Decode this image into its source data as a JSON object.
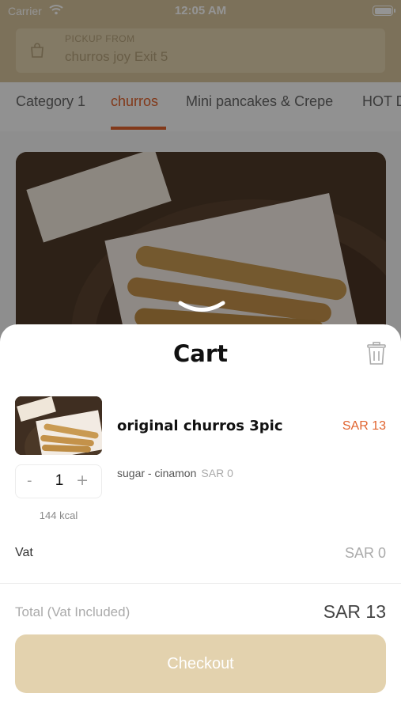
{
  "status_bar": {
    "carrier": "Carrier",
    "time": "12:05 AM"
  },
  "header": {
    "pickup_label": "PICKUP FROM",
    "pickup_value": "churros joy Exit 5"
  },
  "tabs": [
    {
      "label": "Category 1",
      "active": false
    },
    {
      "label": "churros",
      "active": true
    },
    {
      "label": "Mini pancakes & Crepe",
      "active": false
    },
    {
      "label": "HOT D",
      "active": false
    }
  ],
  "cart": {
    "title": "Cart",
    "item": {
      "name": "original churros 3pic",
      "price": "SAR 13",
      "options": "sugar -  cinamon",
      "option_price": "SAR 0",
      "quantity": "1",
      "minus": "-",
      "plus": "+",
      "kcal": "144 kcal"
    },
    "vat_label": "Vat",
    "vat_value": "SAR 0",
    "total_label": "Total",
    "total_note": "(Vat Included)",
    "total_value": "SAR 13",
    "checkout_label": "Checkout"
  },
  "colors": {
    "accent": "#e0632e",
    "brand_beige": "#e3d2ae",
    "header_beige": "#d6c39b"
  },
  "icons": {
    "wifi": "wifi-icon",
    "battery": "battery-icon",
    "bag": "shopping-bag-icon",
    "chevron": "chevron-down-icon",
    "trash": "trash-icon"
  }
}
